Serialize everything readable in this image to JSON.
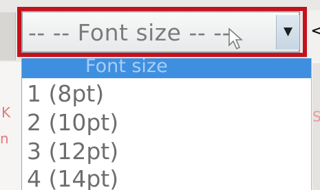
{
  "font_size_select": {
    "value": "-- -- Font size -- --",
    "arrow_icon": "triangle-down-icon"
  },
  "dropdown": {
    "options": [
      {
        "label": "Font size",
        "selected": true
      },
      {
        "label": "1 (8pt)"
      },
      {
        "label": "2 (10pt)"
      },
      {
        "label": "3 (12pt)"
      },
      {
        "label": "4 (14pt)"
      }
    ]
  },
  "background": {
    "right_mark": "<",
    "left_fragments": [
      "K",
      "n"
    ],
    "right_fragment": "S"
  },
  "colors": {
    "highlight": "#c3121c",
    "selected_row": "#3f8fe0"
  }
}
